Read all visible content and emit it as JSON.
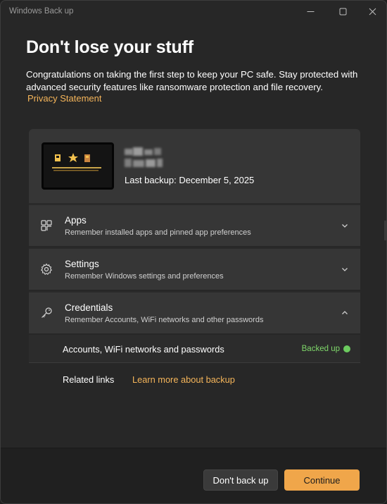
{
  "window": {
    "title": "Windows Back up"
  },
  "page": {
    "heading": "Don't lose your stuff",
    "intro": "Congratulations on taking the first step to keep your PC safe. Stay protected with advanced security features like ransomware protection and file recovery.",
    "privacy_link": "Privacy Statement"
  },
  "device": {
    "last_backup": "Last backup: December 5, 2025"
  },
  "sections": [
    {
      "title": "Apps",
      "subtitle": "Remember installed apps and pinned app preferences",
      "icon": "apps-icon",
      "expanded": false
    },
    {
      "title": "Settings",
      "subtitle": "Remember Windows settings and preferences",
      "icon": "gear-icon",
      "expanded": false
    },
    {
      "title": "Credentials",
      "subtitle": "Remember Accounts, WiFi networks and other passwords",
      "icon": "key-icon",
      "expanded": true
    }
  ],
  "credentials_detail": {
    "label": "Accounts, WiFi networks and passwords",
    "status": "Backed up"
  },
  "related": {
    "label": "Related links",
    "link": "Learn more about backup"
  },
  "footer": {
    "secondary": "Don't back up",
    "primary": "Continue"
  },
  "colors": {
    "accent": "#f0a64a",
    "link": "#f5b55a",
    "success": "#6ccb5f"
  }
}
